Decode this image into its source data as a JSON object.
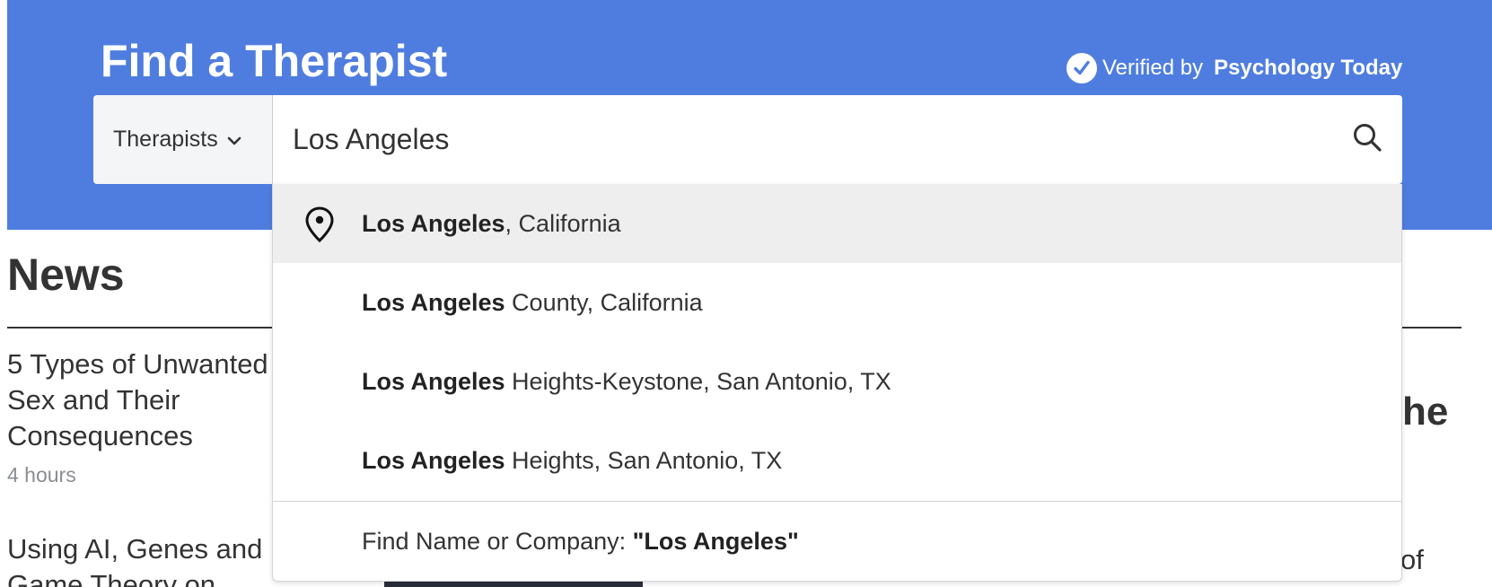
{
  "header": {
    "title": "Find a Therapist",
    "verified_prefix": "Verified by",
    "verified_brand": "Psychology Today"
  },
  "search": {
    "type_label": "Therapists",
    "value": "Los Angeles",
    "placeholder": ""
  },
  "dropdown": {
    "items": [
      {
        "bold": "Los Angeles",
        "rest": ", California",
        "icon": "location-pin-icon"
      },
      {
        "bold": "Los Angeles",
        "rest": " County, California"
      },
      {
        "bold": "Los Angeles",
        "rest": " Heights-Keystone, San Antonio, TX"
      },
      {
        "bold": "Los Angeles",
        "rest": " Heights, San Antonio, TX"
      }
    ],
    "footer_prefix": "Find Name or Company: ",
    "footer_query": "\"Los Angeles\""
  },
  "news": {
    "title": "News",
    "articles": [
      {
        "title": "5 Types of Unwanted Sex and Their Consequences",
        "time": "4 hours"
      },
      {
        "title": "Using AI, Genes and Game Theory on"
      }
    ],
    "right_fragment_1": "he",
    "right_fragment_2": "of"
  },
  "colors": {
    "banner": "#4f7ddf",
    "active_row": "#eeeeee"
  }
}
